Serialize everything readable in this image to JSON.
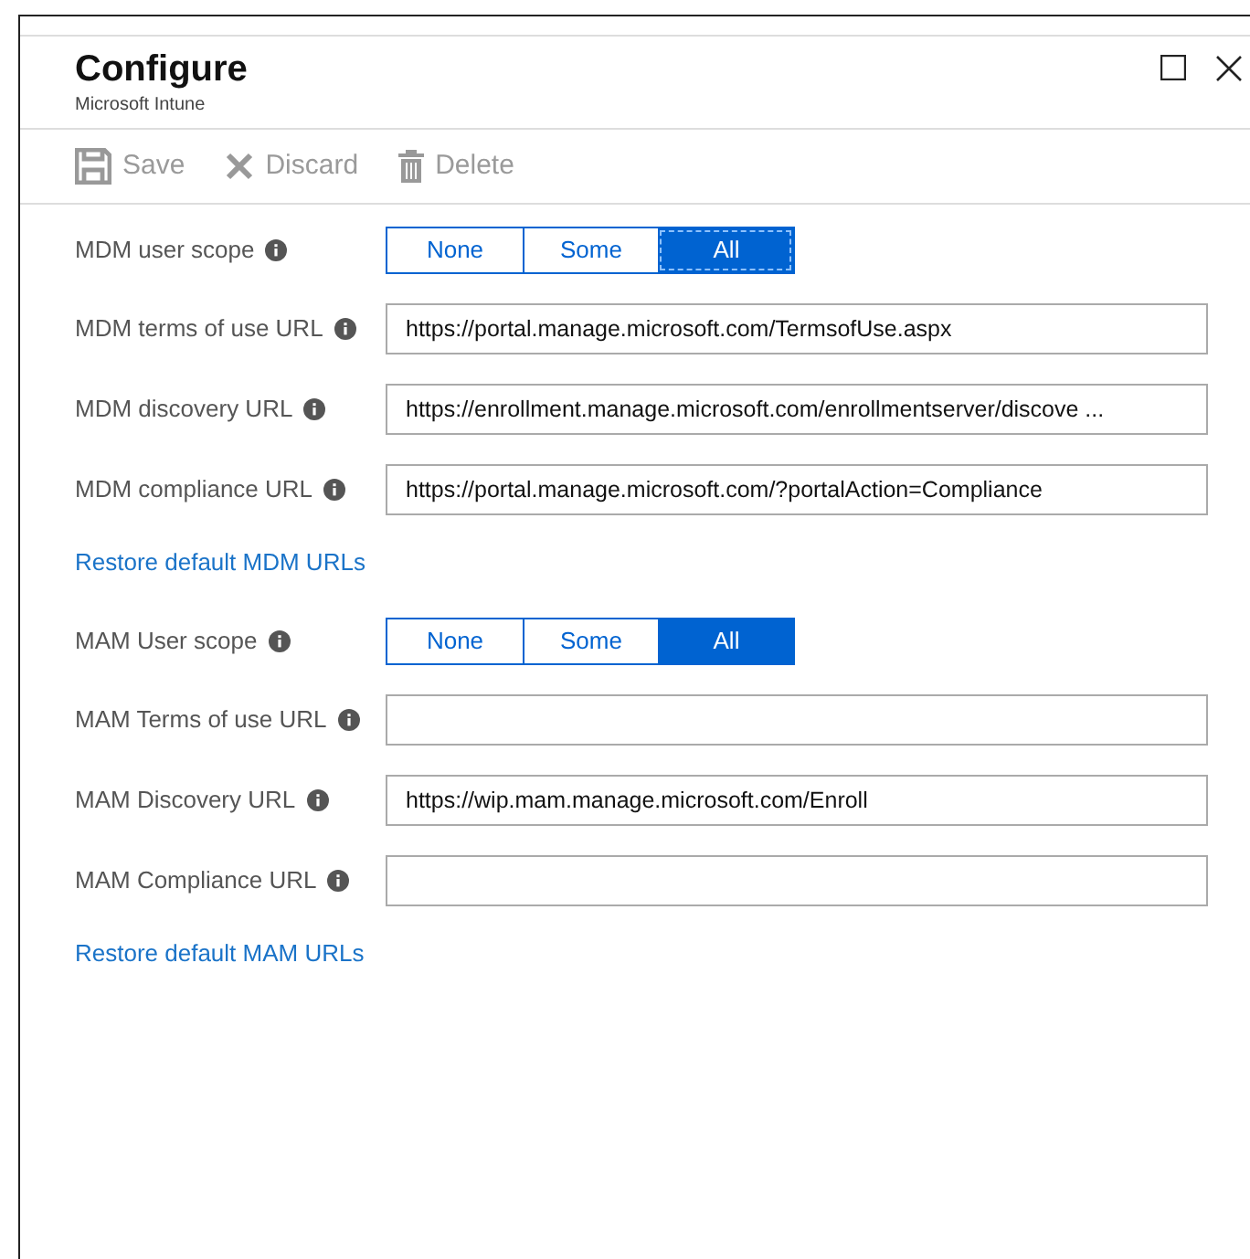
{
  "window": {
    "title": "Configure",
    "subtitle": "Microsoft Intune"
  },
  "toolbar": [
    {
      "kind": "save",
      "label": "Save",
      "disabled": true
    },
    {
      "kind": "discard",
      "label": "Discard",
      "disabled": true
    },
    {
      "kind": "delete",
      "label": "Delete",
      "disabled": true
    }
  ],
  "sections": [
    {
      "scope": {
        "label": "MDM user scope",
        "options": [
          {
            "label": "None",
            "selected": false,
            "focused": false
          },
          {
            "label": "Some",
            "selected": false,
            "focused": false
          },
          {
            "label": "All",
            "selected": true,
            "focused": true
          }
        ]
      },
      "fields": [
        {
          "label": "MDM terms of use URL",
          "value": "https://portal.manage.microsoft.com/TermsofUse.aspx"
        },
        {
          "label": "MDM discovery URL",
          "value": "https://enrollment.manage.microsoft.com/enrollmentserver/discove ..."
        },
        {
          "label": "MDM compliance URL",
          "value": "https://portal.manage.microsoft.com/?portalAction=Compliance"
        }
      ],
      "link": "Restore default MDM URLs"
    },
    {
      "scope": {
        "label": "MAM User scope",
        "options": [
          {
            "label": "None",
            "selected": false,
            "focused": false
          },
          {
            "label": "Some",
            "selected": false,
            "focused": false
          },
          {
            "label": "All",
            "selected": true,
            "focused": false
          }
        ]
      },
      "fields": [
        {
          "label": "MAM Terms of use URL"
        },
        {
          "label": "MAM Discovery URL",
          "value": "https://wip.mam.manage.microsoft.com/Enroll"
        },
        {
          "label": "MAM Compliance URL"
        }
      ],
      "link": "Restore default MAM URLs"
    }
  ]
}
